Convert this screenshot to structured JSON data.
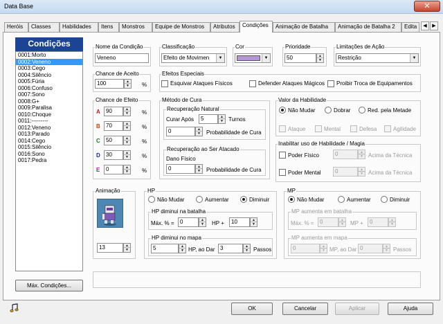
{
  "window": {
    "title": "Data Base",
    "close": "✕"
  },
  "tabs": [
    "Heróis",
    "Classes",
    "Habilidades",
    "Itens",
    "Monstros",
    "Equipe de Monstros",
    "Atributos",
    "Condições",
    "Animação de Batalha",
    "Animação de Batalha 2",
    "Edita"
  ],
  "tab_nav": {
    "left": "◀",
    "right": "▶"
  },
  "conditions": {
    "header": "Condições",
    "items": [
      "0001:Morto",
      "0002:Veneno",
      "0003:Cego",
      "0004:Silêncio",
      "0005:Fúria",
      "0006:Confuso",
      "0007:Sono",
      "0008:G+",
      "0009:Paralisa",
      "0010:Choque",
      "0011:---------",
      "0012:Veneno",
      "0013:Parado",
      "0014:Cego",
      "0015:Silêncio",
      "0016:Sono",
      "0017:Pedra"
    ],
    "selected_index": 1,
    "max_button": "Máx. Condições..."
  },
  "name": {
    "label": "Nome da Condição",
    "value": "Veneno"
  },
  "classification": {
    "label": "Classificação",
    "value": "Efeito de Movimen"
  },
  "color": {
    "label": "Cor",
    "value": "#b698d8"
  },
  "priority": {
    "label": "Prioridade",
    "value": "50"
  },
  "action_limit": {
    "label": "Limitações de Ação",
    "value": "Restrição"
  },
  "hit_chance": {
    "label": "Chance de Aceito",
    "value": "100",
    "unit": "%"
  },
  "special_effects": {
    "label": "Efeitos Especiais",
    "options": [
      "Esquivar Ataques Físicos",
      "Defender Ataques Mágicos",
      "Proibir Troca de Equipamentos"
    ]
  },
  "effect_chance": {
    "label": "Chance de Efeito",
    "unit": "%",
    "rows": [
      {
        "letter": "A",
        "value": "90",
        "color": "#c01818"
      },
      {
        "letter": "B",
        "value": "70",
        "color": "#d04010"
      },
      {
        "letter": "C",
        "value": "50",
        "color": "#1a7a1a"
      },
      {
        "letter": "D",
        "value": "30",
        "color": "#2020a0"
      },
      {
        "letter": "E",
        "value": "0",
        "color": "#a020a0"
      }
    ]
  },
  "cure_method": {
    "label": "Método de Cura",
    "natural": {
      "label": "Recuperação Natural",
      "after_label": "Curar Após",
      "turns_value": "5",
      "turns_label": "Turnos",
      "prob_value": "0",
      "prob_label": "Probabilidade de Cura"
    },
    "attacked": {
      "label": "Recuperação ao Ser Atacado",
      "damage_label": "Dano Físico",
      "prob_value": "0",
      "prob_label": "Probabilidade de Cura"
    }
  },
  "ability_value": {
    "label": "Valor da Habilidade",
    "radios": [
      "Não Mudar",
      "Dobrar",
      "Red. pela Metade"
    ],
    "checks": [
      "Ataque",
      "Mental",
      "Defesa",
      "Agilidade"
    ]
  },
  "disable_skill": {
    "label": "Inabilitar uso de Habilidade / Magia",
    "physical_label": "Poder Físico",
    "physical_value": "0",
    "mental_label": "Poder Mental",
    "mental_value": "0",
    "above_label": "Acima da Técnica"
  },
  "animation": {
    "label": "Animação",
    "value": "13"
  },
  "hp": {
    "label": "HP",
    "radios": [
      "Não Mudar",
      "Aumentar",
      "Diminuir"
    ],
    "battle": {
      "label": "HP diminui na batalha",
      "max_label": "Máx. % =",
      "max_value": "0",
      "plus_label": "HP +",
      "plus_value": "10"
    },
    "map": {
      "label": "HP diminui no mapa",
      "value": "5",
      "mid_label": "HP, ao Dar",
      "steps_value": "3",
      "steps_label": "Passos"
    }
  },
  "mp": {
    "label": "MP",
    "radios": [
      "Não Mudar",
      "Aumentar",
      "Diminuir"
    ],
    "battle": {
      "label": "MP aumenta em batalha",
      "max_label": "Máx. % =",
      "max_value": "0",
      "plus_label": "MP +",
      "plus_value": "0"
    },
    "map": {
      "label": "MP aumenta em mapa",
      "value": "0",
      "mid_label": "MP, ao Dar",
      "steps_value": "0",
      "steps_label": "Passos"
    }
  },
  "buttons": {
    "ok": "OK",
    "cancel": "Cancelar",
    "apply": "Aplicar",
    "help": "Ajuda"
  }
}
